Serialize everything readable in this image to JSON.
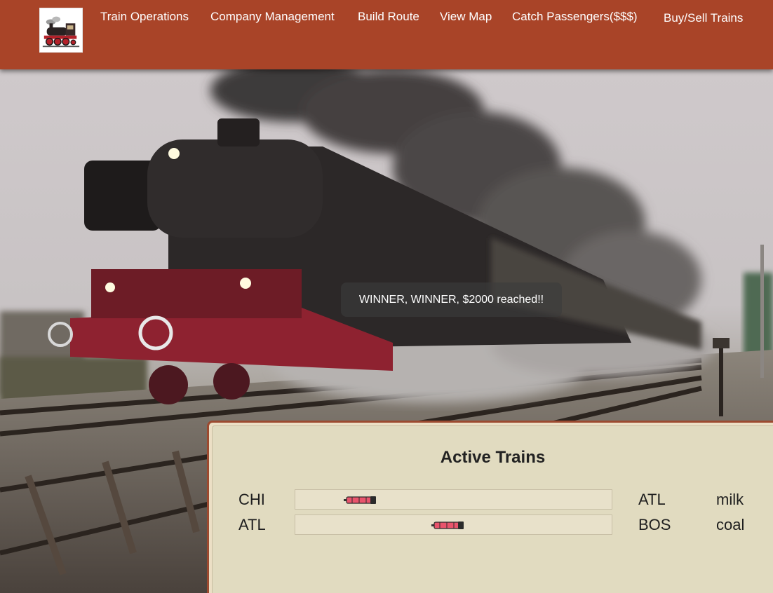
{
  "nav": {
    "logo_icon": "steam-locomotive-logo",
    "links": [
      {
        "label": "Train Operations"
      },
      {
        "label": "Company Management"
      },
      {
        "label": "Build Route"
      },
      {
        "label": "View Map"
      },
      {
        "label": "Catch Passengers($$$)"
      },
      {
        "label": "Buy/Sell Trains"
      }
    ],
    "background_color": "#a94428"
  },
  "hero": {
    "image_icon": "steam-locomotive-photo"
  },
  "toast": {
    "message": "WINNER, WINNER, $2000 reached!!"
  },
  "active_trains": {
    "title": "Active Trains",
    "trains": [
      {
        "origin": "CHI",
        "destination": "ATL",
        "cargo": "milk",
        "progress": 0.16
      },
      {
        "origin": "ATL",
        "destination": "BOS",
        "cargo": "coal",
        "progress": 0.47
      }
    ],
    "train_icon": "train-icon",
    "train_color": "#e9546c"
  }
}
